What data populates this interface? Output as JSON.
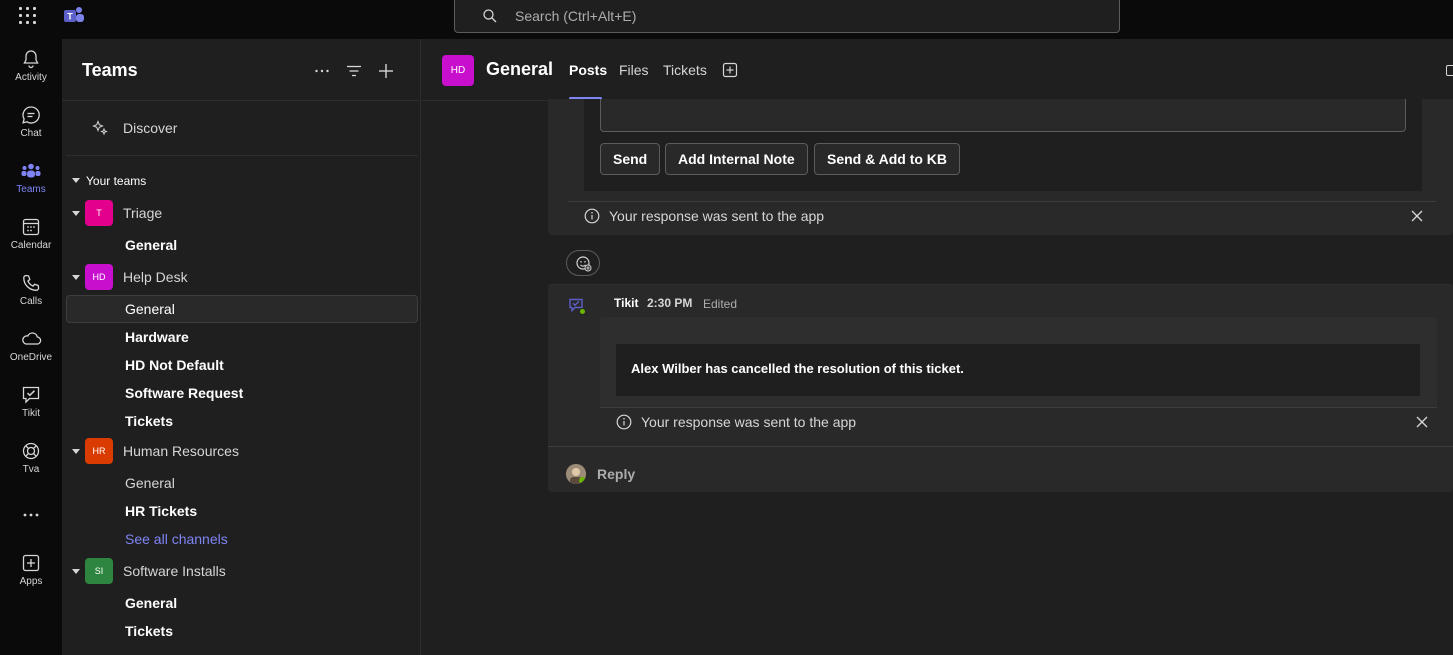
{
  "topbar": {
    "search_placeholder": "Search (Ctrl+Alt+E)"
  },
  "rail": {
    "items": [
      {
        "label": "Activity",
        "icon": "bell-icon"
      },
      {
        "label": "Chat",
        "icon": "chat-icon"
      },
      {
        "label": "Teams",
        "icon": "teams-icon",
        "active": true
      },
      {
        "label": "Calendar",
        "icon": "calendar-icon"
      },
      {
        "label": "Calls",
        "icon": "phone-icon"
      },
      {
        "label": "OneDrive",
        "icon": "cloud-icon"
      },
      {
        "label": "Tikit",
        "icon": "tikit-icon"
      },
      {
        "label": "Tva",
        "icon": "lifebuoy-icon"
      },
      {
        "label": "",
        "icon": "more-icon"
      },
      {
        "label": "Apps",
        "icon": "add-app-icon"
      }
    ]
  },
  "panel": {
    "title": "Teams",
    "discover": "Discover",
    "section": "Your teams",
    "teams": [
      {
        "name": "Triage",
        "initials": "T",
        "color": "#e3008c",
        "channels": [
          {
            "label": "General",
            "bold": true
          }
        ]
      },
      {
        "name": "Help Desk",
        "initials": "HD",
        "color": "#c90fce",
        "channels": [
          {
            "label": "General",
            "bold": false,
            "selected": true
          },
          {
            "label": "Hardware",
            "bold": true
          },
          {
            "label": "HD Not Default",
            "bold": true
          },
          {
            "label": "Software Request",
            "bold": true
          },
          {
            "label": "Tickets",
            "bold": true
          }
        ]
      },
      {
        "name": "Human Resources",
        "initials": "HR",
        "color": "#da3b01",
        "channels": [
          {
            "label": "General",
            "bold": false
          },
          {
            "label": "HR Tickets",
            "bold": true
          },
          {
            "label": "See all channels",
            "link": true
          }
        ]
      },
      {
        "name": "Software Installs",
        "initials": "SI",
        "color": "#2e8540",
        "channels": [
          {
            "label": "General",
            "bold": true
          },
          {
            "label": "Tickets",
            "bold": true
          }
        ]
      }
    ]
  },
  "channel": {
    "avatar": "HD",
    "title": "General",
    "tabs": [
      "Posts",
      "Files",
      "Tickets"
    ]
  },
  "thread1": {
    "buttons": [
      "Send",
      "Add Internal Note",
      "Send & Add to KB"
    ],
    "notice": "Your response was sent to the app"
  },
  "thread2": {
    "author": "Tikit",
    "time": "2:30 PM",
    "edited": "Edited",
    "message": "Alex Wilber has cancelled the resolution of this ticket.",
    "notice": "Your response was sent to the app",
    "reply": "Reply"
  },
  "colors": {
    "accent": "#7f85f5",
    "background": "#1f1f1f",
    "rail": "#0a0a0a",
    "presence": "#6bb700"
  }
}
